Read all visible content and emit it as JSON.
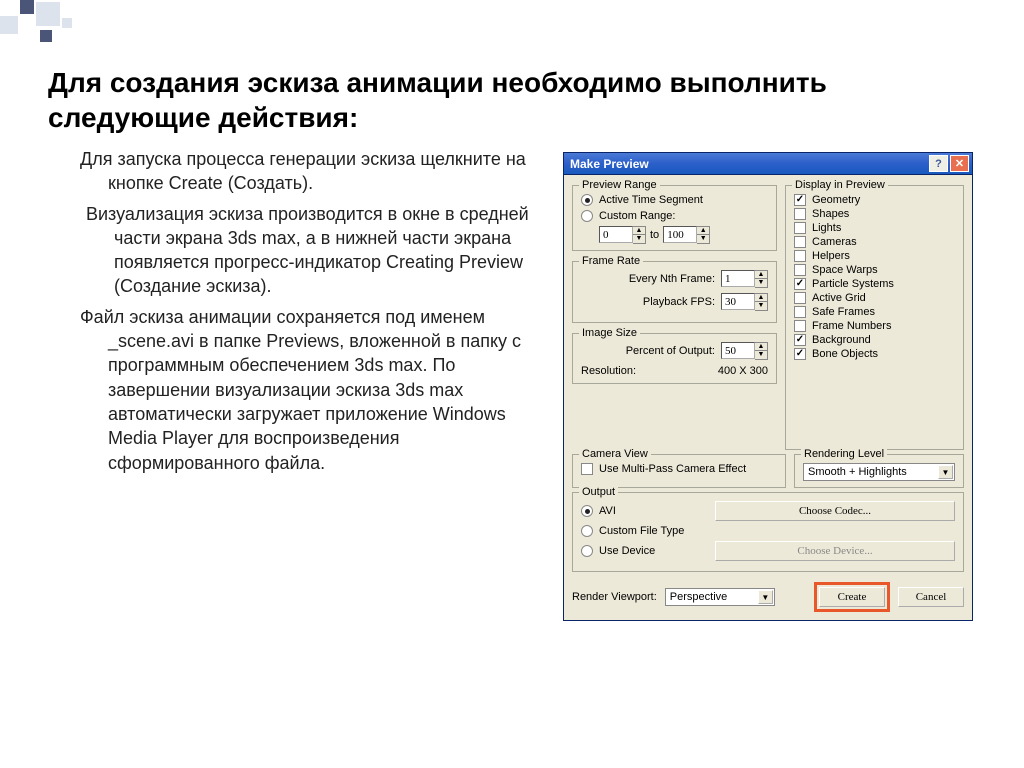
{
  "slide": {
    "title": "Для создания эскиза анимации необходимо выполнить следующие действия:",
    "para1": "Для запуска процесса генерации эскиза щелкните на кнопке Create (Создать).",
    "para2": "Визуализация эскиза производится в окне в средней части экрана 3ds max, а в нижней части экрана появляется прогресс-индикатор Creating Preview (Создание эскиза).",
    "para3": "Файл эскиза анимации сохраняется под именем _scene.avi в папке Previews, вложенной в папку с программным обеспечением 3ds max. По завершении визуализации эскиза 3ds max автоматически загружает приложение Windows Media Player для воспроизведения сформированного файла."
  },
  "dialog": {
    "title": "Make Preview",
    "preview_range": {
      "legend": "Preview Range",
      "active": "Active Time Segment",
      "custom": "Custom Range:",
      "from": "0",
      "to_lbl": "to",
      "to": "100"
    },
    "frame_rate": {
      "legend": "Frame Rate",
      "every": "Every Nth Frame:",
      "every_val": "1",
      "fps": "Playback FPS:",
      "fps_val": "30"
    },
    "image_size": {
      "legend": "Image Size",
      "percent": "Percent of Output:",
      "percent_val": "50",
      "res_lbl": "Resolution:",
      "res_val": "400  X  300"
    },
    "display": {
      "legend": "Display in Preview",
      "items": [
        {
          "label": "Geometry",
          "on": true
        },
        {
          "label": "Shapes",
          "on": false
        },
        {
          "label": "Lights",
          "on": false
        },
        {
          "label": "Cameras",
          "on": false
        },
        {
          "label": "Helpers",
          "on": false
        },
        {
          "label": "Space Warps",
          "on": false
        },
        {
          "label": "Particle Systems",
          "on": true
        },
        {
          "label": "Active Grid",
          "on": false
        },
        {
          "label": "Safe Frames",
          "on": false
        },
        {
          "label": "Frame Numbers",
          "on": false
        },
        {
          "label": "Background",
          "on": true
        },
        {
          "label": "Bone Objects",
          "on": true
        }
      ]
    },
    "camera": {
      "legend": "Camera View",
      "multipass": "Use Multi-Pass Camera Effect"
    },
    "rendering_level": {
      "legend": "Rendering Level",
      "val": "Smooth + Highlights"
    },
    "output": {
      "legend": "Output",
      "avi": "AVI",
      "codec": "Choose Codec...",
      "custom": "Custom File Type",
      "device": "Use Device",
      "choose_device": "Choose Device..."
    },
    "footer": {
      "viewport_lbl": "Render Viewport:",
      "viewport_val": "Perspective",
      "create": "Create",
      "cancel": "Cancel"
    }
  }
}
